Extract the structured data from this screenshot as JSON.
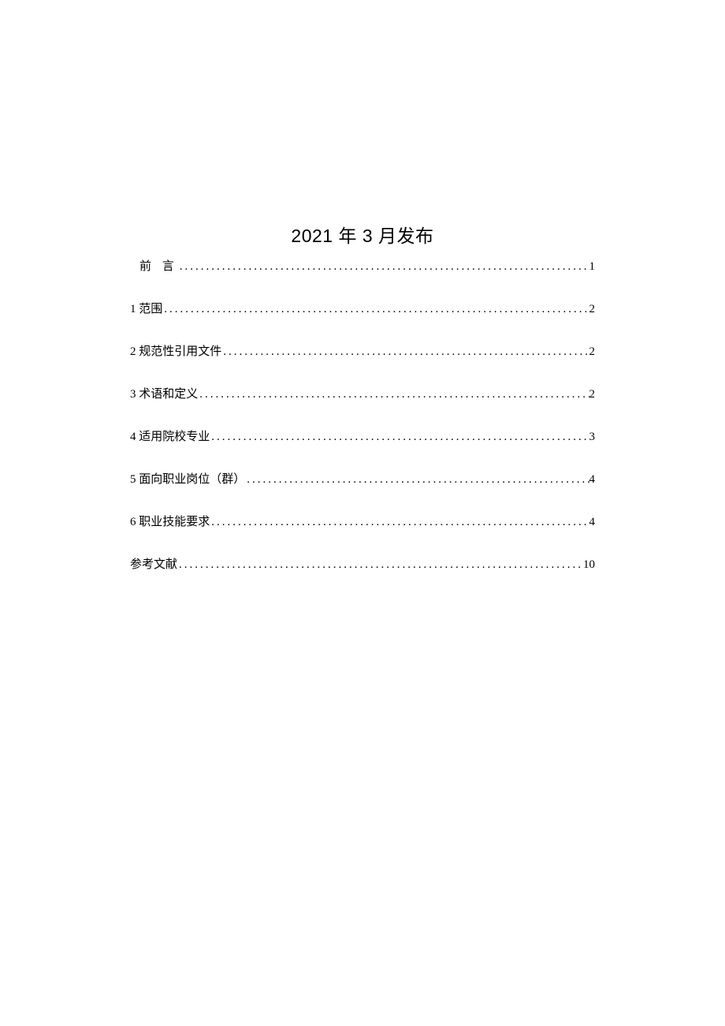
{
  "title": "2021 年 3 月发布",
  "toc": [
    {
      "label": "前 言",
      "page": "1",
      "spaced": true,
      "indent": true
    },
    {
      "label": "1 范围",
      "page": "2",
      "spaced": false,
      "indent": false
    },
    {
      "label": "2 规范性引用文件",
      "page": "2",
      "spaced": false,
      "indent": false
    },
    {
      "label": "3 术语和定义",
      "page": "2",
      "spaced": false,
      "indent": false
    },
    {
      "label": "4 适用院校专业",
      "page": "3",
      "spaced": false,
      "indent": false
    },
    {
      "label": "5 面向职业岗位（群）",
      "page": "4",
      "spaced": false,
      "indent": false
    },
    {
      "label": "6 职业技能要求",
      "page": "4",
      "spaced": false,
      "indent": false
    },
    {
      "label": "参考文献",
      "page": "10",
      "spaced": false,
      "indent": false
    }
  ]
}
